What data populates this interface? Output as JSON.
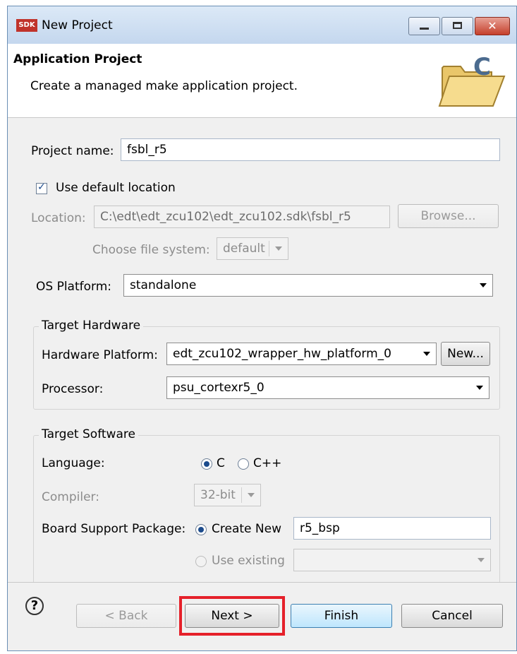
{
  "window": {
    "app_icon": "SDK",
    "title": "New Project",
    "minimize_glyph": "",
    "maximize_glyph": "",
    "close_glyph": "✕"
  },
  "header": {
    "title": "Application Project",
    "description": "Create a managed make application project."
  },
  "form": {
    "project_name_label": "Project name:",
    "project_name_value": "fsbl_r5",
    "use_default_location_label": "Use default location",
    "use_default_location_checked": true,
    "location_label": "Location:",
    "location_value": "C:\\edt\\edt_zcu102\\edt_zcu102.sdk\\fsbl_r5",
    "browse_label": "Browse...",
    "file_system_label": "Choose file system:",
    "file_system_value": "default",
    "os_platform_label": "OS Platform:",
    "os_platform_value": "standalone"
  },
  "target_hardware": {
    "title": "Target Hardware",
    "hw_platform_label": "Hardware Platform:",
    "hw_platform_value": "edt_zcu102_wrapper_hw_platform_0",
    "new_label": "New...",
    "processor_label": "Processor:",
    "processor_value": "psu_cortexr5_0"
  },
  "target_software": {
    "title": "Target Software",
    "language_label": "Language:",
    "language_c": "C",
    "language_cpp": "C++",
    "compiler_label": "Compiler:",
    "compiler_value": "32-bit",
    "bsp_label": "Board Support Package:",
    "create_new_label": "Create New",
    "bsp_name_value": "r5_bsp",
    "use_existing_label": "Use existing"
  },
  "footer": {
    "help_glyph": "?",
    "back_label": "< Back",
    "next_label": "Next >",
    "finish_label": "Finish",
    "cancel_label": "Cancel"
  },
  "colors": {
    "highlight": "#e5202a",
    "accent": "#1c4b8c"
  }
}
